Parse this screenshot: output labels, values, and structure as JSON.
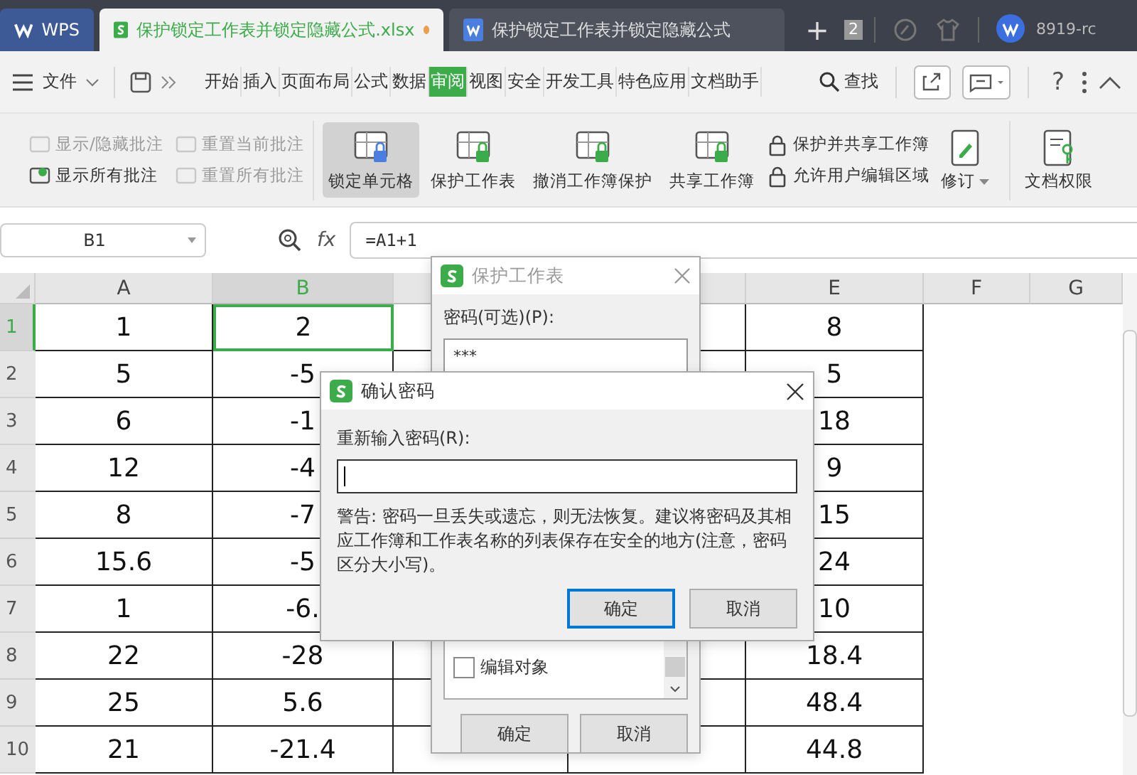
{
  "tabs": [
    {
      "label": "WPS",
      "kind": "home",
      "selected": false,
      "unsaved": false
    },
    {
      "label": "保护锁定工作表并锁定隐藏公式.xlsx",
      "kind": "sheet",
      "selected": true,
      "unsaved": true
    },
    {
      "label": "保护锁定工作表并锁定隐藏公式",
      "kind": "doc",
      "selected": false,
      "unsaved": false
    }
  ],
  "tab_bar": {
    "new_tab": "+",
    "window_count": "2",
    "user": "8919-rc"
  },
  "menu": {
    "file": "文件",
    "items": [
      {
        "label": "开始",
        "selected": false
      },
      {
        "label": "插入",
        "selected": false
      },
      {
        "label": "页面布局",
        "selected": false
      },
      {
        "label": "公式",
        "selected": false
      },
      {
        "label": "数据",
        "selected": false
      },
      {
        "label": "审阅",
        "selected": true
      },
      {
        "label": "视图",
        "selected": false
      },
      {
        "label": "安全",
        "selected": false
      },
      {
        "label": "开发工具",
        "selected": false
      },
      {
        "label": "特色应用",
        "selected": false
      },
      {
        "label": "文档助手",
        "selected": false
      }
    ],
    "search": "查找",
    "help": "?"
  },
  "ribbon": {
    "comment_items": [
      {
        "label": "显示/隐藏批注",
        "disabled": true
      },
      {
        "label": "重置当前批注",
        "disabled": true
      },
      {
        "label": "显示所有批注",
        "disabled": false
      },
      {
        "label": "重置所有批注",
        "disabled": true
      }
    ],
    "buttons": [
      {
        "label": "锁定单元格",
        "selected": true
      },
      {
        "label": "保护工作表",
        "selected": false
      },
      {
        "label": "撤消工作簿保护",
        "selected": false
      },
      {
        "label": "共享工作簿",
        "selected": false
      }
    ],
    "small_buttons": [
      "保护并共享工作簿",
      "允许用户编辑区域"
    ],
    "revise": "修订",
    "rights": "文档权限"
  },
  "formula_bar": {
    "cell": "B1",
    "fx": "fx",
    "formula": "=A1+1"
  },
  "sheet": {
    "columns": [
      {
        "label": "A",
        "selected": false
      },
      {
        "label": "B",
        "selected": true
      },
      {
        "selected": false
      },
      {
        "selected": false
      },
      {
        "label": "E",
        "selected": false
      },
      {
        "label": "F",
        "selected": false
      },
      {
        "label": "G",
        "selected": false
      }
    ],
    "rows": [
      {
        "label": "1",
        "selected": true,
        "cells": {
          "A": "1",
          "B": "2",
          "E": "8"
        }
      },
      {
        "label": "2",
        "selected": false,
        "cells": {
          "A": "5",
          "B": "-5",
          "E": "5"
        }
      },
      {
        "label": "3",
        "selected": false,
        "cells": {
          "A": "6",
          "B": "-1",
          "E": "18"
        }
      },
      {
        "label": "4",
        "selected": false,
        "cells": {
          "A": "12",
          "B": "-4",
          "E": "9"
        }
      },
      {
        "label": "5",
        "selected": false,
        "cells": {
          "A": "8",
          "B": "-7",
          "E": "15"
        }
      },
      {
        "label": "6",
        "selected": false,
        "cells": {
          "A": "15.6",
          "B": "-5",
          "E": "24"
        }
      },
      {
        "label": "7",
        "selected": false,
        "cells": {
          "A": "1",
          "B": "-6.",
          "E": "10"
        }
      },
      {
        "label": "8",
        "selected": false,
        "cells": {
          "A": "22",
          "B": "-28",
          "E": "18.4"
        }
      },
      {
        "label": "9",
        "selected": false,
        "cells": {
          "A": "25",
          "B": "5.6",
          "E": "48.4"
        }
      },
      {
        "label": "10",
        "selected": false,
        "cells": {
          "A": "21",
          "B": "-21.4",
          "E": "44.8"
        }
      }
    ]
  },
  "protect_dialog": {
    "title": "保护工作表",
    "password_label": "密码(可选)(P):",
    "password": "***",
    "options": [
      {
        "label": "编辑对象",
        "checked": false
      }
    ],
    "ok": "确定",
    "cancel": "取消"
  },
  "confirm_dialog": {
    "title": "确认密码",
    "label": "重新输入密码(R):",
    "warning": "警告: 密码一旦丢失或遗忘，则无法恢复。建议将密码及其相应工作簿和工作表名称的列表保存在安全的地方(注意，密码区分大小写)。",
    "ok": "确定",
    "cancel": "取消"
  }
}
